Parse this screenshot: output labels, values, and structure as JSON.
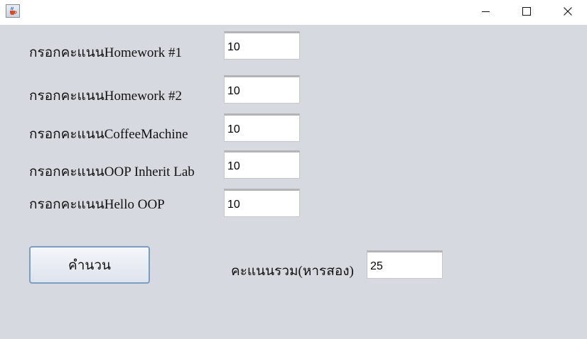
{
  "window": {
    "icon": "java-cup-icon",
    "controls": [
      "minimize-icon",
      "maximize-icon",
      "close-icon"
    ]
  },
  "form": {
    "rows": [
      {
        "label": "กรอกคะแนนHomework #1",
        "value": "10"
      },
      {
        "label": "กรอกคะแนนHomework #2",
        "value": "10"
      },
      {
        "label": "กรอกคะแนนCoffeeMachine",
        "value": "10"
      },
      {
        "label": "กรอกคะแนนOOP Inherit Lab",
        "value": "10"
      },
      {
        "label": "กรอกคะแนนHello OOP",
        "value": "10"
      }
    ],
    "calculate_label": "คำนวน",
    "total_label": "คะแนนรวม(หารสอง)",
    "total_value": "25"
  }
}
